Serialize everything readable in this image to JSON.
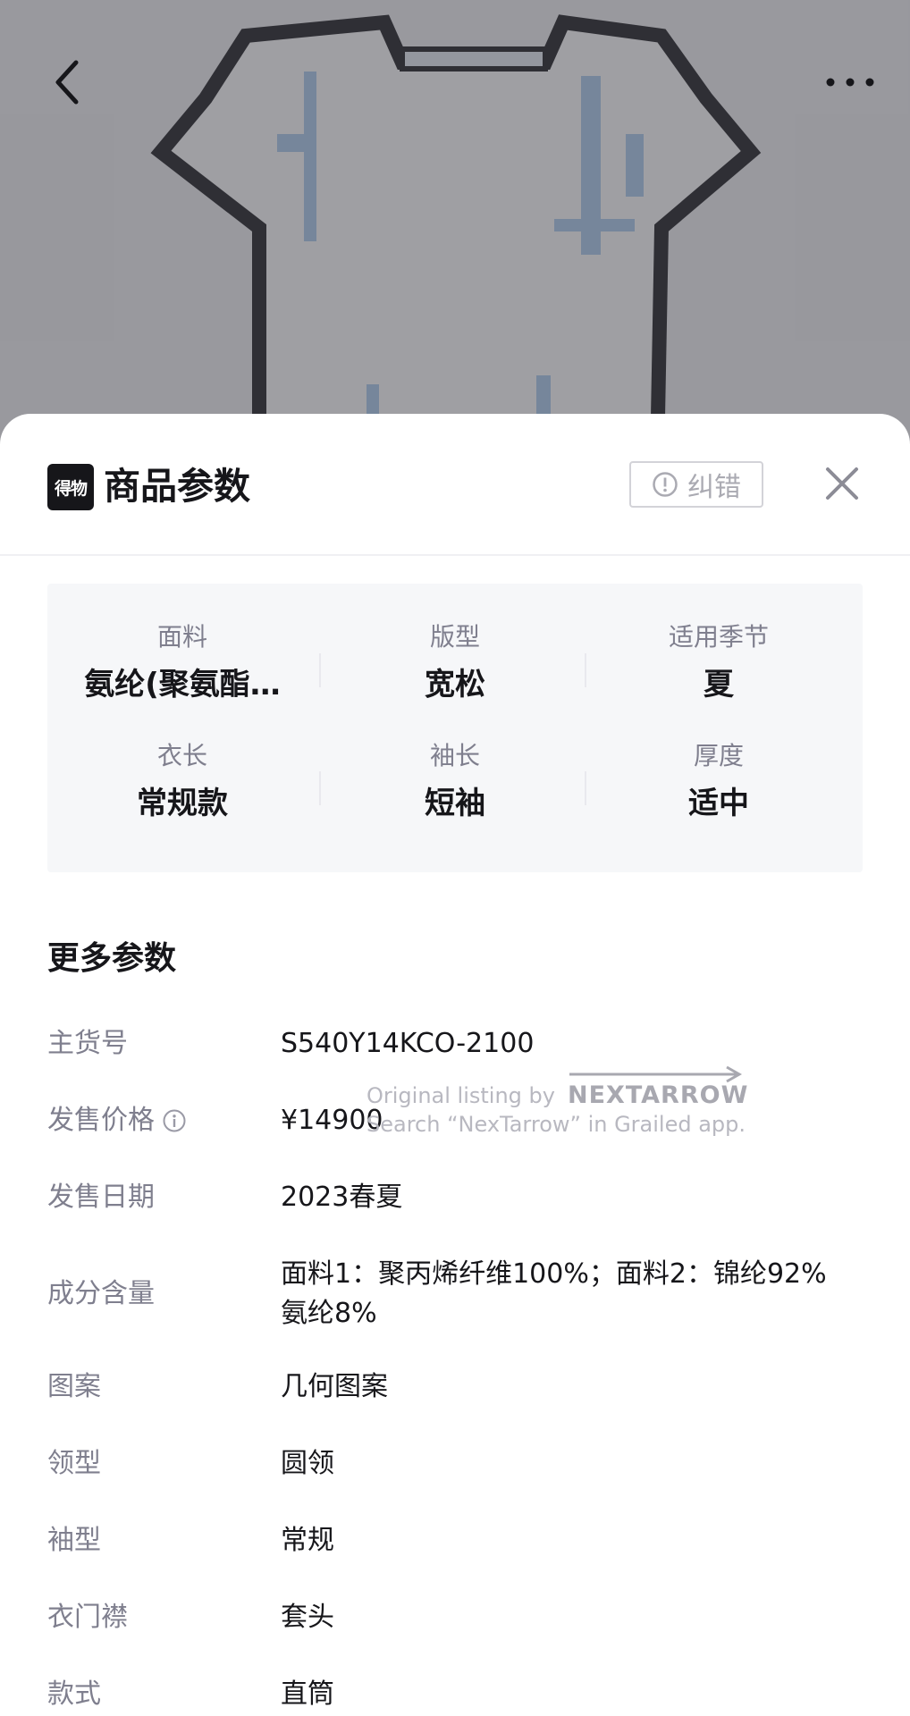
{
  "header": {
    "back_icon": "back-arrow-icon",
    "more_icon": "more-horizontal-icon"
  },
  "sheet": {
    "logo_text": "得物",
    "title": "商品参数",
    "report_label": "纠错",
    "close_icon": "close-icon"
  },
  "key_params": [
    {
      "label": "面料",
      "value": "氨纶(聚氨酯…"
    },
    {
      "label": "版型",
      "value": "宽松"
    },
    {
      "label": "适用季节",
      "value": "夏"
    },
    {
      "label": "衣长",
      "value": "常规款"
    },
    {
      "label": "袖长",
      "value": "短袖"
    },
    {
      "label": "厚度",
      "value": "适中"
    }
  ],
  "more": {
    "title": "更多参数",
    "rows": [
      {
        "key": "主货号",
        "value": "S540Y14KCO-2100"
      },
      {
        "key": "发售价格",
        "value": "¥14900"
      },
      {
        "key": "发售日期",
        "value": "2023春夏"
      },
      {
        "key": "成分含量",
        "value": "面料1：聚丙烯纤维100%；面料2：锦纶92% 氨纶8%"
      },
      {
        "key": "图案",
        "value": "几何图案"
      },
      {
        "key": "领型",
        "value": "圆领"
      },
      {
        "key": "袖型",
        "value": "常规"
      },
      {
        "key": "衣门襟",
        "value": "套头"
      },
      {
        "key": "款式",
        "value": "直筒"
      }
    ]
  },
  "watermark": {
    "line1": "Original listing by",
    "brand": "NEXTARROW",
    "line2": "Search “NexTarrow” in Grailed app."
  },
  "colors": {
    "primary_text": "#16161a",
    "secondary_text": "#7f7f8e",
    "panel_bg": "#f6f7f9"
  }
}
